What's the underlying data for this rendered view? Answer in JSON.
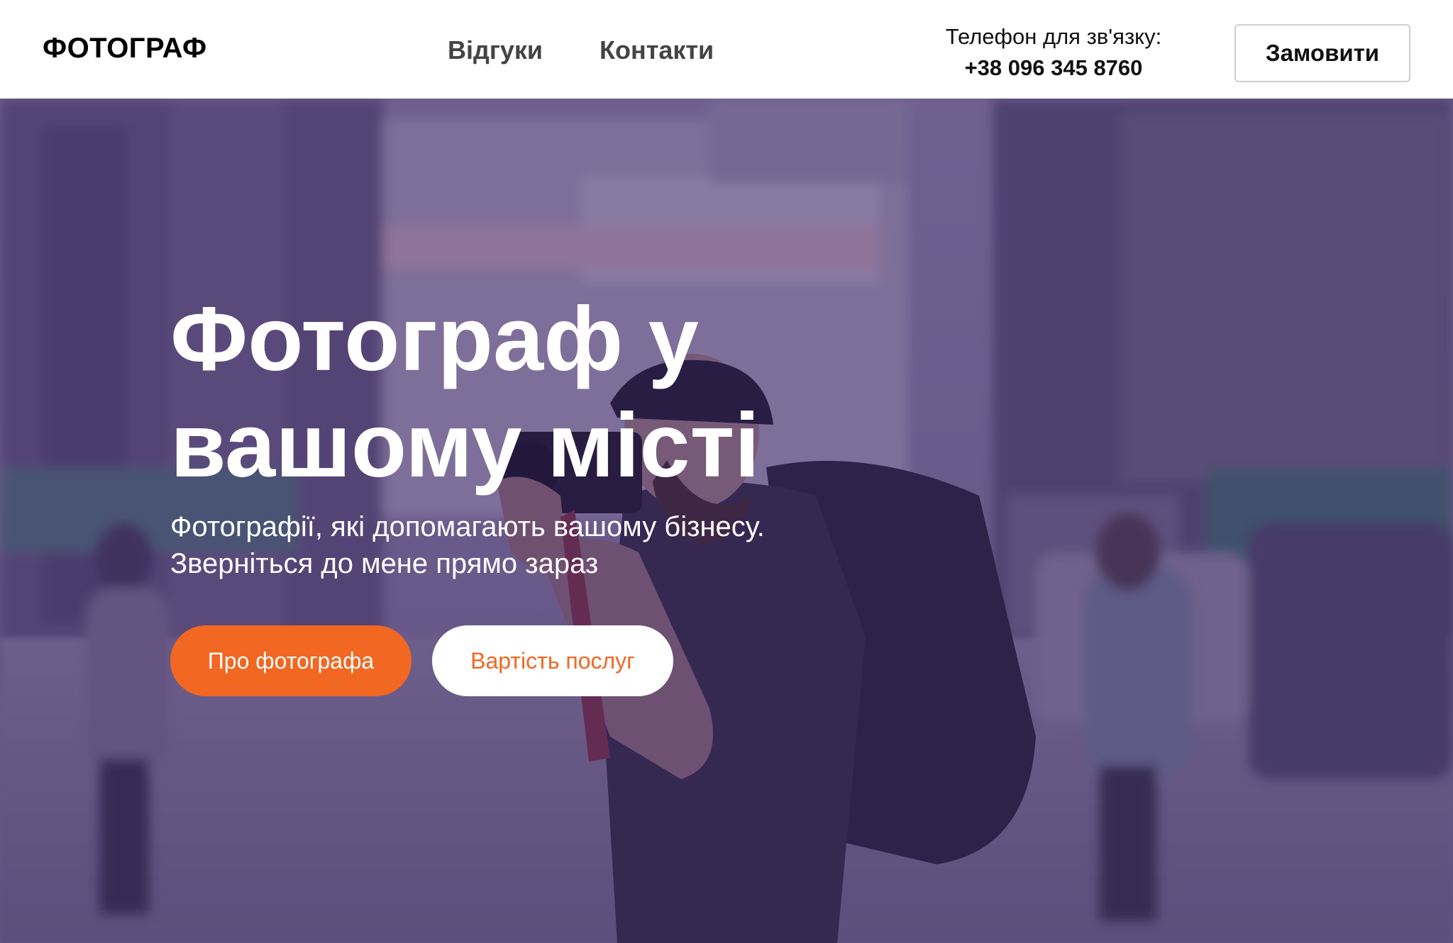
{
  "header": {
    "logo": "ФОТОГРАФ",
    "nav": {
      "reviews": "Відгуки",
      "contacts": "Контакти"
    },
    "phone_label": "Телефон для зв'язку:",
    "phone_number": "+38 096 345 8760",
    "order_button": "Замовити"
  },
  "hero": {
    "title": "Фотограф у вашому місті",
    "subtitle_line1": "Фотографії, які допомагають вашому бізнесу.",
    "subtitle_line2": "Зверніться до мене прямо зараз",
    "button_about": "Про фотографа",
    "button_prices": "Вартість послуг"
  },
  "colors": {
    "accent": "#f26722",
    "overlay": "#462d78",
    "header_bg": "#ffffff",
    "nav_text": "#444444"
  }
}
